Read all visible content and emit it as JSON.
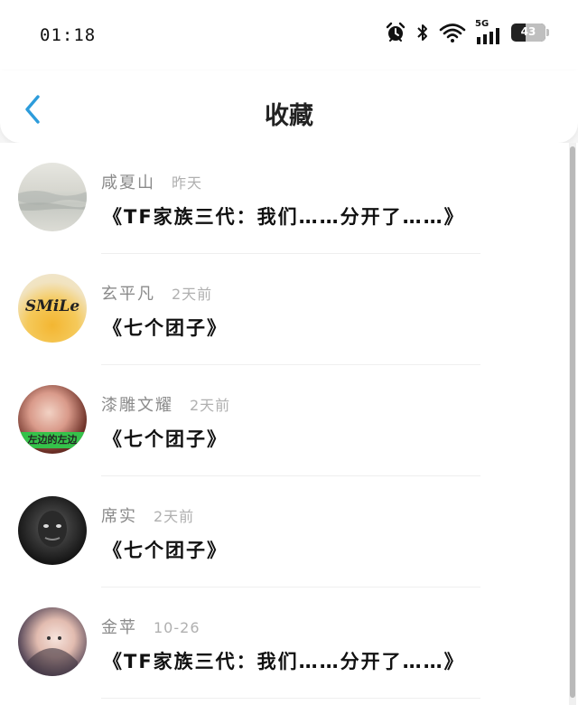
{
  "status_bar": {
    "time": "01:18",
    "network": "5G",
    "battery": "43",
    "icons": [
      "alarm-icon",
      "bluetooth-icon",
      "wifi-icon",
      "signal-icon",
      "battery-icon"
    ]
  },
  "header": {
    "title": "收藏",
    "back_icon": "chevron-left-icon"
  },
  "colors": {
    "accent": "#2d9cdb",
    "name_text": "#8a8a8a",
    "time_text": "#b0b0b0"
  },
  "favorites": [
    {
      "name": "咸夏山",
      "time": "昨天",
      "work": "《TF家族三代：我们……分开了……》"
    },
    {
      "name": "玄平凡",
      "time": "2天前",
      "work": "《七个团子》"
    },
    {
      "name": "漆雕文耀",
      "time": "2天前",
      "work": "《七个团子》"
    },
    {
      "name": "席实",
      "time": "2天前",
      "work": "《七个团子》"
    },
    {
      "name": "金苹",
      "time": "10-26",
      "work": "《TF家族三代：我们……分开了……》"
    }
  ],
  "avatar_text": {
    "smile": "SMiLe",
    "caption": "左边的左边"
  }
}
